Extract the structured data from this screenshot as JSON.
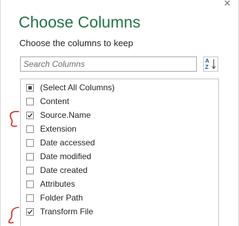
{
  "dialog": {
    "close_glyph": "×",
    "title": "Choose Columns",
    "subtitle": "Choose the columns to keep",
    "search_placeholder": "Search Columns",
    "sort_label": "A Z"
  },
  "columns": [
    {
      "label": "(Select All Columns)",
      "state": "partial"
    },
    {
      "label": "Content",
      "state": "unchecked"
    },
    {
      "label": "Source.Name",
      "state": "checked"
    },
    {
      "label": "Extension",
      "state": "unchecked"
    },
    {
      "label": "Date accessed",
      "state": "unchecked"
    },
    {
      "label": "Date modified",
      "state": "unchecked"
    },
    {
      "label": "Date created",
      "state": "unchecked"
    },
    {
      "label": "Attributes",
      "state": "unchecked"
    },
    {
      "label": "Folder Path",
      "state": "unchecked"
    },
    {
      "label": "Transform File",
      "state": "checked"
    }
  ],
  "colors": {
    "title": "#217346",
    "annotation": "#e0201b"
  },
  "icons": {
    "close": "close-icon",
    "sort": "sort-az-icon",
    "annotation": "red-hand-drawn-mark"
  }
}
